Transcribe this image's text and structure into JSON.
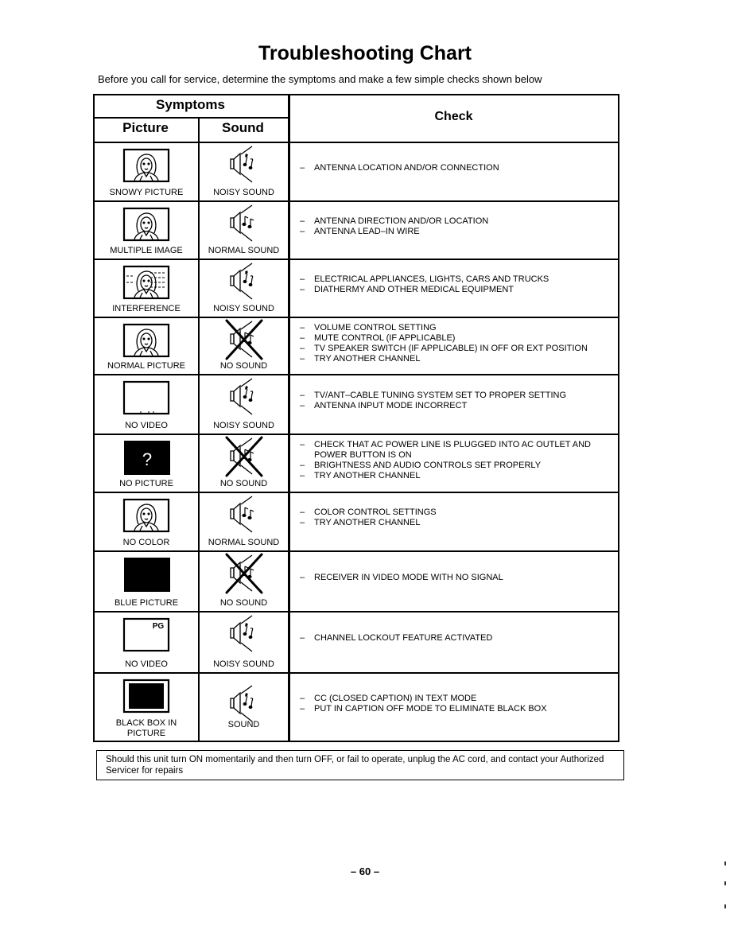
{
  "page": {
    "title": "Troubleshooting Chart",
    "subtitle": "Before you call for service, determine the symptoms and make a few simple checks shown below",
    "page_number": "– 60 –"
  },
  "table": {
    "headers": {
      "symptoms": "Symptoms",
      "picture": "Picture",
      "sound": "Sound",
      "check": "Check"
    },
    "rows": [
      {
        "picture_label": "SNOWY PICTURE",
        "picture_icon": "tv-face-icon",
        "sound_label": "NOISY SOUND",
        "sound_icon": "speaker-noisy-icon",
        "checks": [
          "ANTENNA LOCATION AND/OR CONNECTION"
        ]
      },
      {
        "picture_label": "MULTIPLE IMAGE",
        "picture_icon": "tv-face-icon",
        "sound_label": "NORMAL SOUND",
        "sound_icon": "speaker-normal-icon",
        "checks": [
          "ANTENNA DIRECTION AND/OR LOCATION",
          "ANTENNA LEAD–IN WIRE"
        ]
      },
      {
        "picture_label": "INTERFERENCE",
        "picture_icon": "tv-face-interference-icon",
        "sound_label": "NOISY SOUND",
        "sound_icon": "speaker-noisy-icon",
        "checks": [
          "ELECTRICAL APPLIANCES, LIGHTS, CARS AND TRUCKS",
          "DIATHERMY AND OTHER MEDICAL EQUIPMENT"
        ]
      },
      {
        "picture_label": "NORMAL PICTURE",
        "picture_icon": "tv-face-icon",
        "sound_label": "NO SOUND",
        "sound_icon": "speaker-muted-icon",
        "checks": [
          "VOLUME CONTROL SETTING",
          "MUTE CONTROL (IF APPLICABLE)",
          "TV SPEAKER SWITCH (IF APPLICABLE) IN OFF OR EXT POSITION",
          "TRY ANOTHER CHANNEL"
        ]
      },
      {
        "picture_label": "NO VIDEO",
        "picture_icon": "tv-blank-icon",
        "sound_label": "NOISY SOUND",
        "sound_icon": "speaker-noisy-icon",
        "checks": [
          "TV/ANT–CABLE TUNING SYSTEM SET TO PROPER SETTING",
          "ANTENNA INPUT MODE INCORRECT"
        ]
      },
      {
        "picture_label": "NO PICTURE",
        "picture_icon": "tv-question-icon",
        "picture_glyph": "?",
        "sound_label": "NO SOUND",
        "sound_icon": "speaker-muted-icon",
        "checks": [
          "CHECK THAT AC POWER LINE IS PLUGGED INTO AC OUTLET AND POWER BUTTON IS ON",
          "BRIGHTNESS AND AUDIO CONTROLS SET PROPERLY",
          "TRY ANOTHER CHANNEL"
        ]
      },
      {
        "picture_label": "NO COLOR",
        "picture_icon": "tv-face-icon",
        "sound_label": "NORMAL SOUND",
        "sound_icon": "speaker-normal-icon",
        "checks": [
          "COLOR CONTROL SETTINGS",
          "TRY ANOTHER CHANNEL"
        ]
      },
      {
        "picture_label": "BLUE PICTURE",
        "picture_icon": "tv-filled-icon",
        "sound_label": "NO SOUND",
        "sound_icon": "speaker-muted-icon",
        "checks": [
          "RECEIVER IN VIDEO MODE WITH NO SIGNAL"
        ]
      },
      {
        "picture_label": "NO VIDEO",
        "picture_icon": "tv-pg-icon",
        "picture_glyph": "PG",
        "sound_label": "NOISY SOUND",
        "sound_icon": "speaker-noisy-icon",
        "checks": [
          "CHANNEL LOCKOUT FEATURE ACTIVATED"
        ]
      },
      {
        "picture_label": "BLACK BOX IN PICTURE",
        "picture_icon": "tv-black-box-icon",
        "sound_label": "SOUND",
        "sound_icon": "speaker-noisy-icon",
        "checks": [
          "CC (CLOSED CAPTION) IN TEXT MODE",
          "PUT IN CAPTION OFF MODE TO ELIMINATE BLACK BOX"
        ]
      }
    ]
  },
  "note": "Should this unit turn ON momentarily and then turn OFF, or fail to operate, unplug the AC cord, and contact your Authorized Servicer for repairs"
}
